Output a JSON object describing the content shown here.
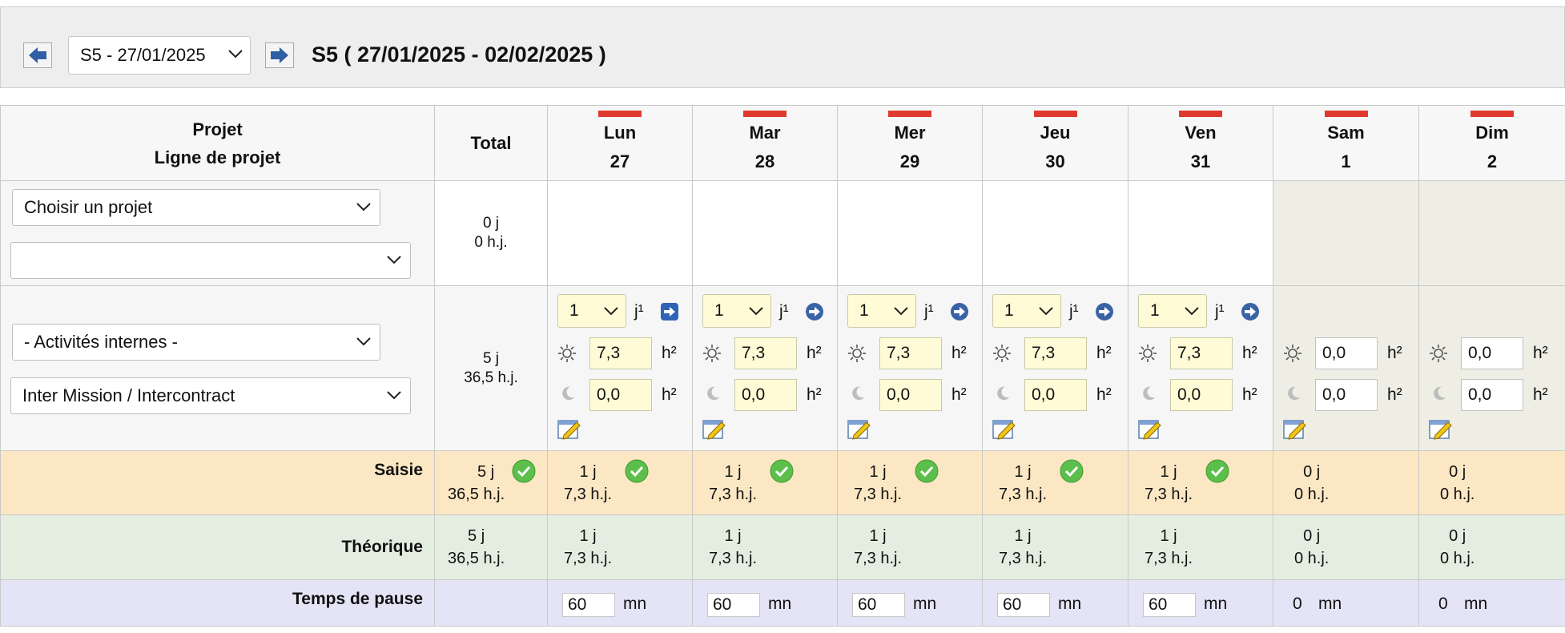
{
  "nav": {
    "week_selected": "S5 - 27/01/2025",
    "week_title": "S5 ( 27/01/2025 - 02/02/2025 )"
  },
  "header": {
    "project_line1": "Projet",
    "project_line2": "Ligne de projet",
    "total": "Total",
    "days": [
      {
        "name": "Lun",
        "num": "27"
      },
      {
        "name": "Mar",
        "num": "28"
      },
      {
        "name": "Mer",
        "num": "29"
      },
      {
        "name": "Jeu",
        "num": "30"
      },
      {
        "name": "Ven",
        "num": "31"
      },
      {
        "name": "Sam",
        "num": "1"
      },
      {
        "name": "Dim",
        "num": "2"
      }
    ]
  },
  "row_new": {
    "project_select": "Choisir un projet",
    "line_select": "",
    "total_days": "0 j",
    "total_hours": "0 h.j."
  },
  "row_internal": {
    "project_select": "- Activités internes -",
    "line_select": "Inter Mission / Intercontract",
    "total_days": "5 j",
    "total_hours": "36,5 h.j.",
    "unit_day": "j¹",
    "unit_hour": "h²",
    "days": [
      {
        "count": "1",
        "day_hours": "7,3",
        "night_hours": "0,0"
      },
      {
        "count": "1",
        "day_hours": "7,3",
        "night_hours": "0,0"
      },
      {
        "count": "1",
        "day_hours": "7,3",
        "night_hours": "0,0"
      },
      {
        "count": "1",
        "day_hours": "7,3",
        "night_hours": "0,0"
      },
      {
        "count": "1",
        "day_hours": "7,3",
        "night_hours": "0,0"
      },
      {
        "day_hours": "0,0",
        "night_hours": "0,0"
      },
      {
        "day_hours": "0,0",
        "night_hours": "0,0"
      }
    ]
  },
  "saisie": {
    "label": "Saisie",
    "total_days": "5 j",
    "total_hours": "36,5 h.j.",
    "days": [
      {
        "d": "1 j",
        "h": "7,3 h.j."
      },
      {
        "d": "1 j",
        "h": "7,3 h.j."
      },
      {
        "d": "1 j",
        "h": "7,3 h.j."
      },
      {
        "d": "1 j",
        "h": "7,3 h.j."
      },
      {
        "d": "1 j",
        "h": "7,3 h.j."
      },
      {
        "d": "0 j",
        "h": "0 h.j."
      },
      {
        "d": "0 j",
        "h": "0 h.j."
      }
    ]
  },
  "theorique": {
    "label": "Théorique",
    "total_days": "5 j",
    "total_hours": "36,5 h.j.",
    "days": [
      {
        "d": "1 j",
        "h": "7,3 h.j."
      },
      {
        "d": "1 j",
        "h": "7,3 h.j."
      },
      {
        "d": "1 j",
        "h": "7,3 h.j."
      },
      {
        "d": "1 j",
        "h": "7,3 h.j."
      },
      {
        "d": "1 j",
        "h": "7,3 h.j."
      },
      {
        "d": "0 j",
        "h": "0 h.j."
      },
      {
        "d": "0 j",
        "h": "0 h.j."
      }
    ]
  },
  "pause": {
    "label": "Temps de pause",
    "unit": "mn",
    "days": [
      "60",
      "60",
      "60",
      "60",
      "60",
      "0",
      "0"
    ]
  },
  "colors": {
    "day_marker": "#e03a2f",
    "saisie_bg": "#fbe7c3",
    "theorique_bg": "#e3eee1",
    "pause_bg": "#e4e4f6",
    "input_bg": "#fffbd6",
    "weekend_bg": "#eeeee4"
  }
}
